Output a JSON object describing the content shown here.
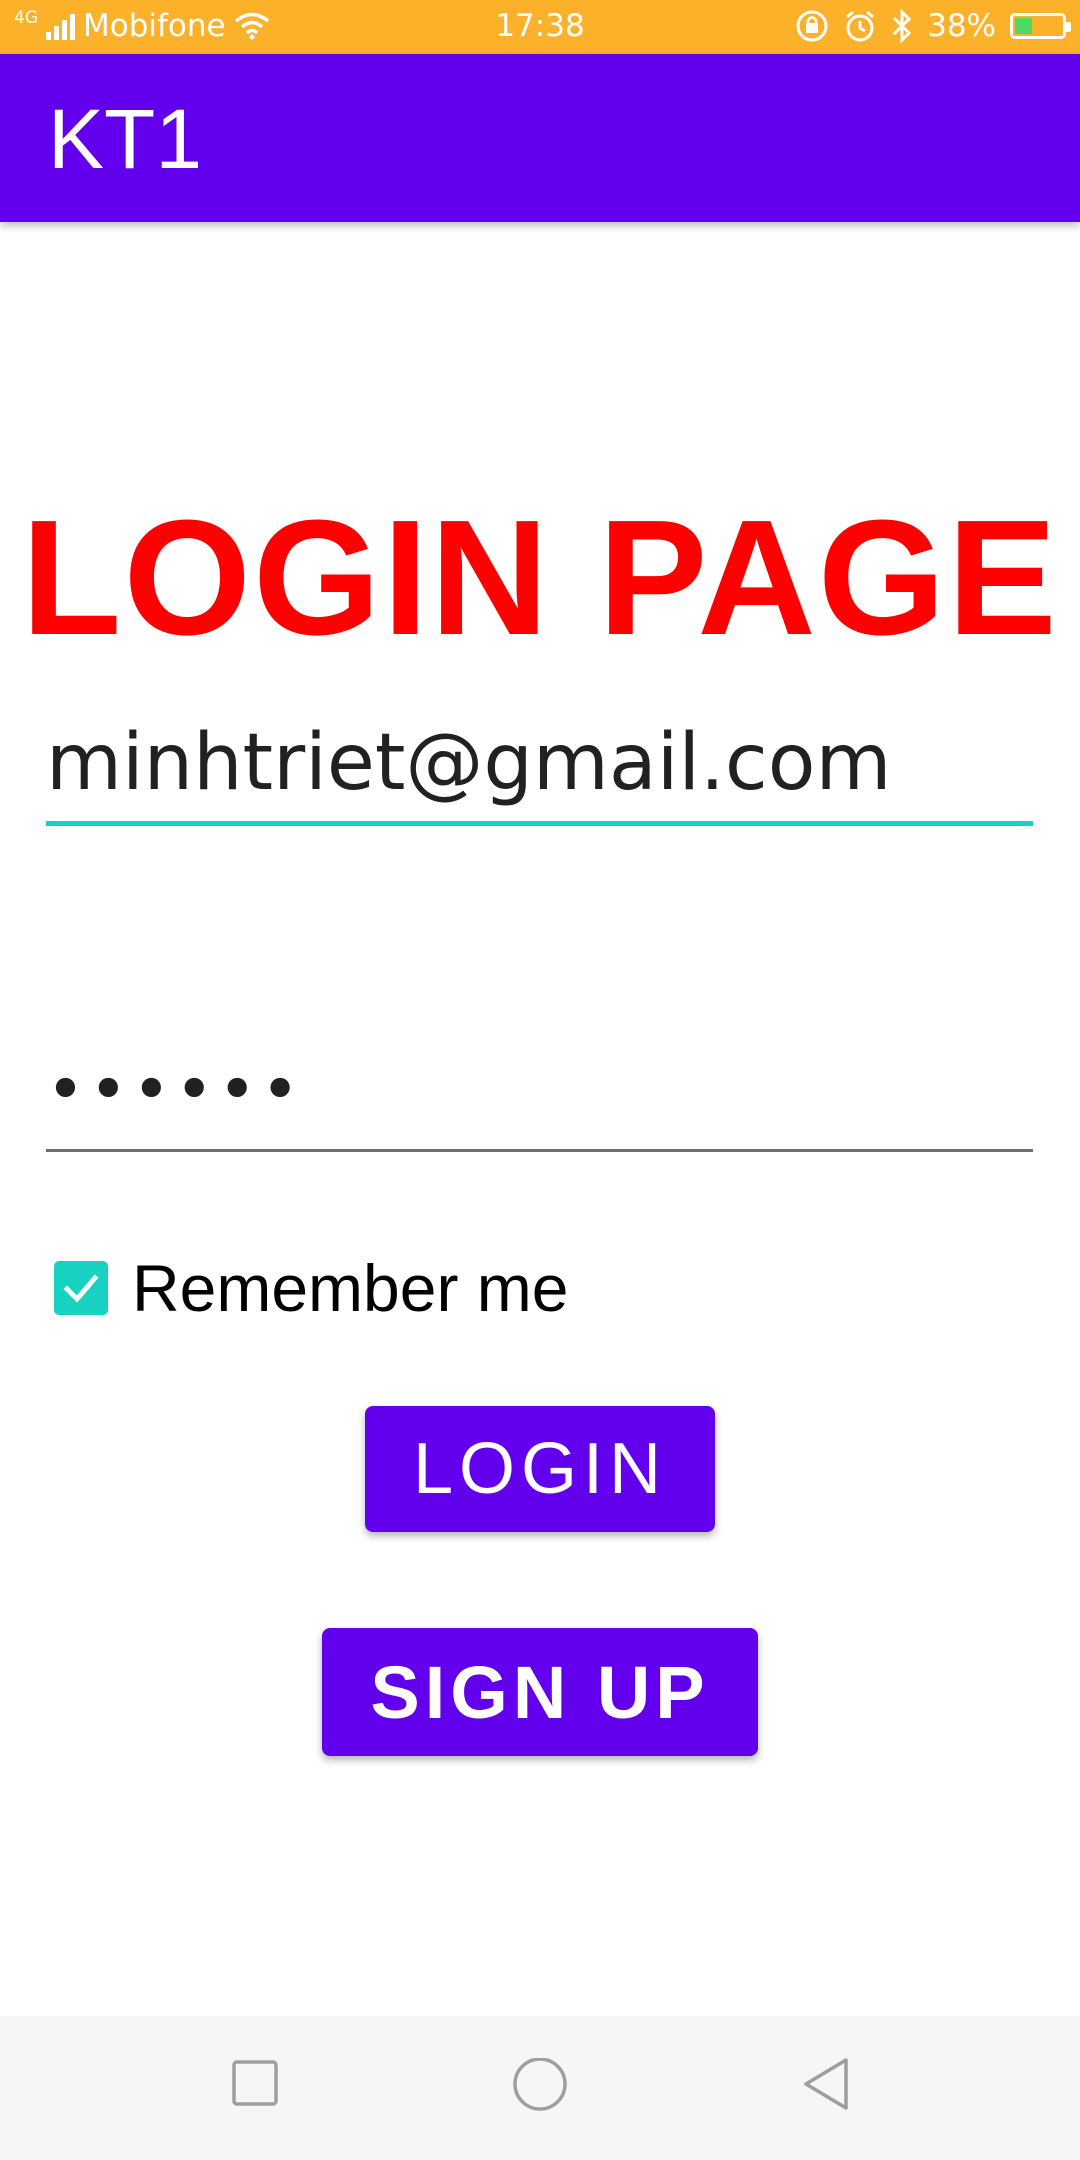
{
  "status_bar": {
    "network": "4G",
    "carrier": "Mobifone",
    "time": "17:38",
    "battery_percent": "38%",
    "battery_level": 0.38,
    "icons": [
      "signal-icon",
      "wifi-icon",
      "rotation-lock-icon",
      "alarm-icon",
      "bluetooth-icon",
      "battery-charging-icon"
    ]
  },
  "app_bar": {
    "title": "KT1",
    "color": "#6200ee"
  },
  "main": {
    "heading": "LOGIN PAGE",
    "heading_color": "#ff0000",
    "email": {
      "value": "minhtriet@gmail.com",
      "focused": true,
      "accent_color": "#17d1c1"
    },
    "password": {
      "value": "••••••"
    },
    "remember_me": {
      "label": "Remember me",
      "checked": true
    },
    "login_button": "LOGIN",
    "signup_button": "SIGN UP"
  },
  "nav_bar": {
    "buttons": [
      "recents-icon",
      "home-icon",
      "back-icon"
    ]
  }
}
